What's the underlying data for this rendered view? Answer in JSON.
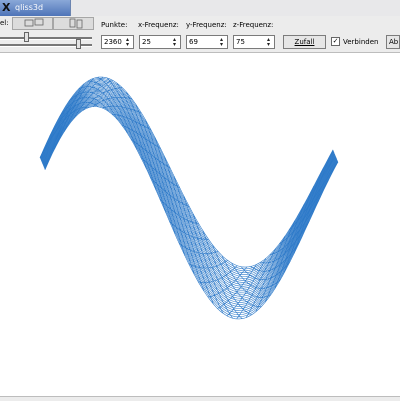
{
  "window": {
    "title": "qliss3d"
  },
  "toolbar": {
    "rotation_label": "el:",
    "points_label": "Punkte:",
    "points_value": "2360",
    "xfreq_label": "x-Frequenz:",
    "xfreq_value": "25",
    "yfreq_label": "y-Frequenz:",
    "yfreq_value": "69",
    "zfreq_label": "z-Frequenz:",
    "zfreq_value": "75",
    "random_button": "Zufall",
    "connect_label": "Verbinden",
    "connect_checked": "✓",
    "about_button": "Ab"
  },
  "plot": {
    "line_color": "#2b78c8"
  }
}
